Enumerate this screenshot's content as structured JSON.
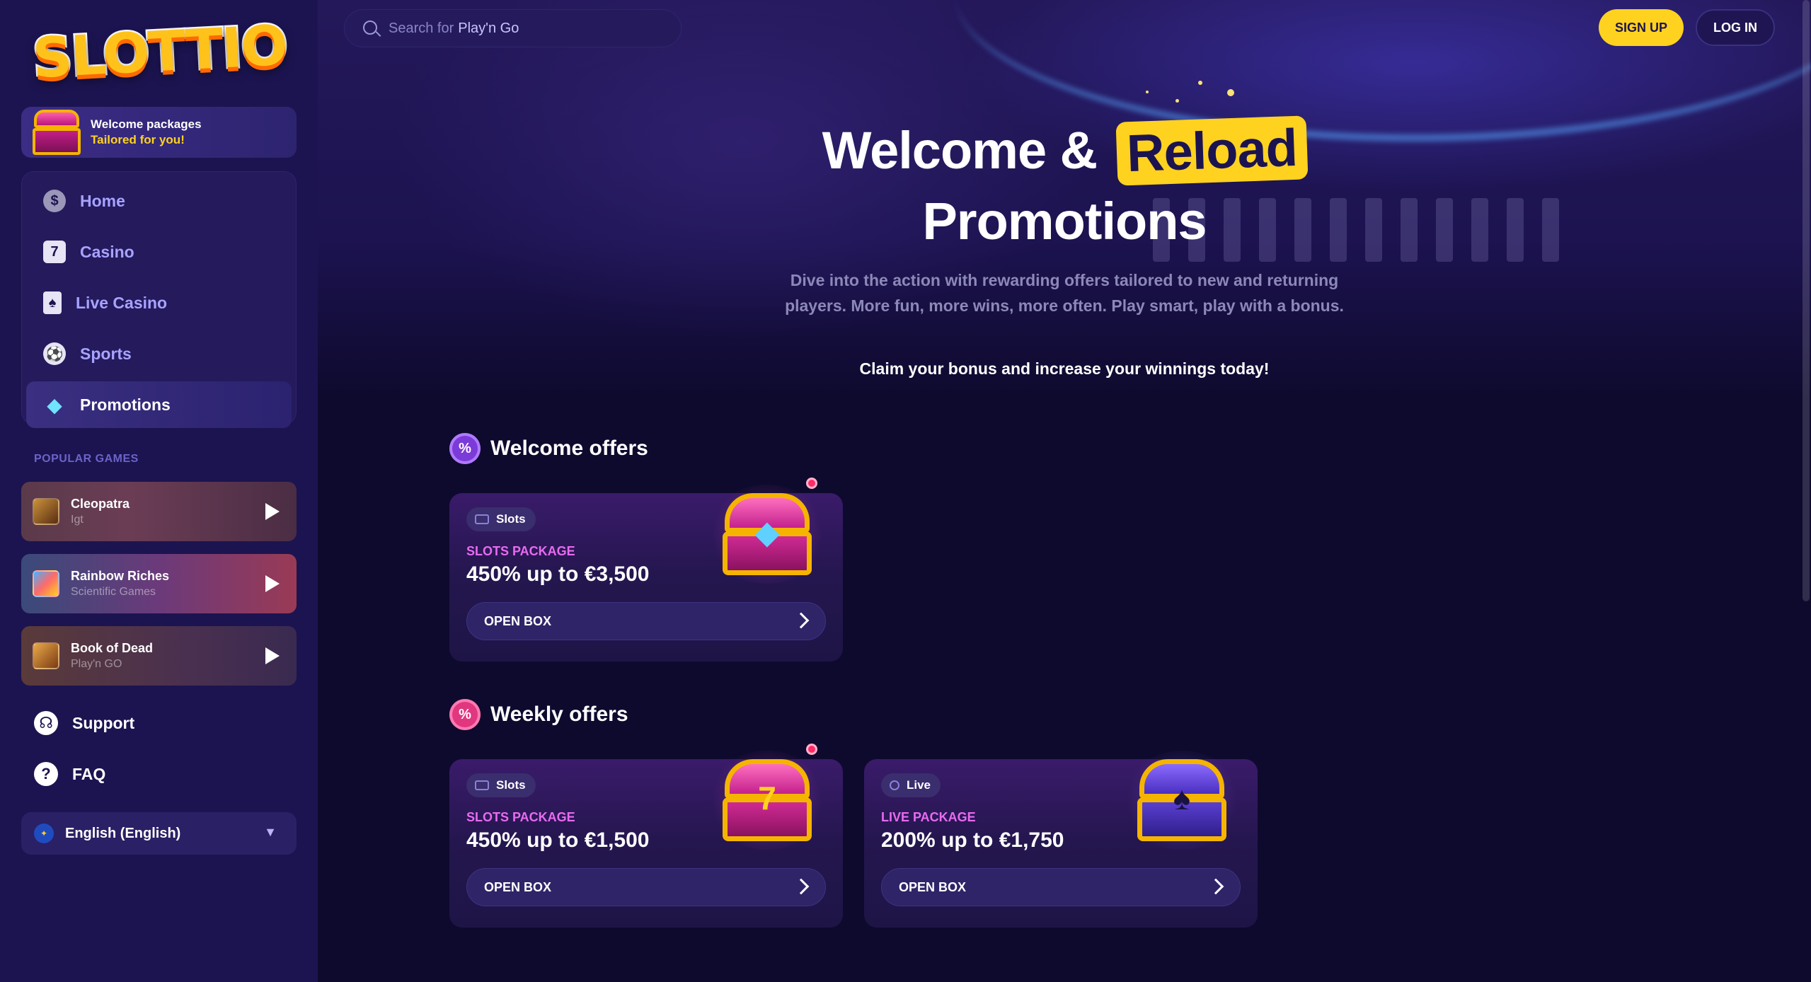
{
  "brand": {
    "logo_text": "SLOTTIO"
  },
  "sidebar": {
    "welcome_banner": {
      "line1": "Welcome packages",
      "line2": "Tailored for you!"
    },
    "nav": [
      {
        "label": "Home",
        "icon": "dollar-coin-icon"
      },
      {
        "label": "Casino",
        "icon": "slot-seven-icon"
      },
      {
        "label": "Live Casino",
        "icon": "playing-card-icon"
      },
      {
        "label": "Sports",
        "icon": "soccer-ball-icon"
      },
      {
        "label": "Promotions",
        "icon": "diamond-icon",
        "active": true
      }
    ],
    "popular_title": "POPULAR GAMES",
    "games": [
      {
        "name": "Cleopatra",
        "provider": "Igt"
      },
      {
        "name": "Rainbow Riches",
        "provider": "Scientific Games"
      },
      {
        "name": "Book of Dead",
        "provider": "Play'n GO"
      }
    ],
    "support_label": "Support",
    "faq_label": "FAQ",
    "language": "English (English)"
  },
  "header": {
    "search": {
      "placeholder_prefix": "Search for",
      "placeholder_highlight": "Play'n Go"
    },
    "signup_label": "SIGN UP",
    "login_label": "LOG IN"
  },
  "hero": {
    "title_part1": "Welcome &",
    "title_highlight": "Reload",
    "title_line2": "Promotions",
    "description": "Dive into the action with rewarding offers tailored to new and returning players. More fun, more wins, more often. Play smart, play with a bonus.",
    "cta": "Claim your bonus and increase your winnings today!"
  },
  "sections": {
    "welcome": {
      "title": "Welcome offers",
      "offers": [
        {
          "tag": "Slots",
          "kicker": "SLOTS PACKAGE",
          "headline": "450% up to €3,500",
          "button": "OPEN BOX",
          "chest": "gem"
        }
      ]
    },
    "weekly": {
      "title": "Weekly offers",
      "offers": [
        {
          "tag": "Slots",
          "kicker": "SLOTS PACKAGE",
          "headline": "450% up to €1,500",
          "button": "OPEN BOX",
          "chest": "seven"
        },
        {
          "tag": "Live",
          "kicker": "LIVE PACKAGE",
          "headline": "200% up to €1,750",
          "button": "OPEN BOX",
          "chest": "spade"
        }
      ]
    }
  },
  "colors": {
    "sidebar_bg": "#1c1450",
    "page_bg": "#0e0a2e",
    "accent_yellow": "#ffd21f",
    "kicker_pink": "#e86bf0"
  }
}
